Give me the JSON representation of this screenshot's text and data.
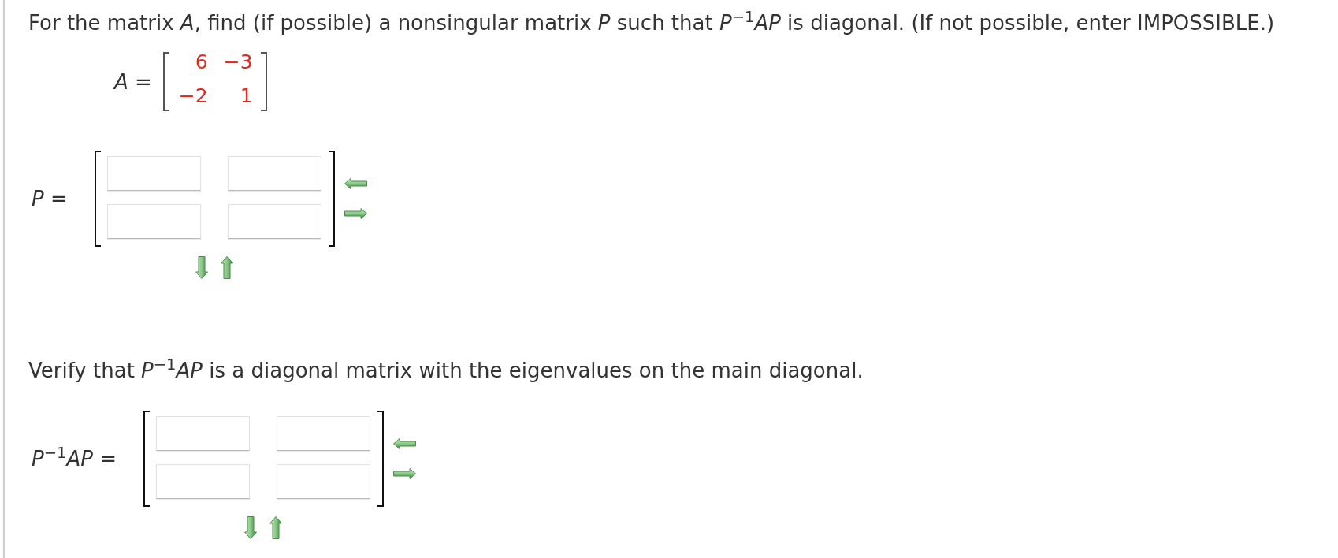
{
  "sections": [
    {
      "kind": "question",
      "text": "For the matrix *A*, find (if possible) a nonsingular matrix *P* such that *P*$^{−1}$*AP* is diagonal. (If not possible, enter IMPOSSIBLE.)"
    },
    {
      "kind": "given_matrix",
      "label": "*A* =",
      "rows": [
        [
          "6",
          "−3"
        ],
        [
          "−2",
          "1"
        ]
      ]
    },
    {
      "kind": "answer_matrix",
      "label": "*P* =",
      "rows": [
        [
          {
            "kind": "input"
          },
          {
            "kind": "input"
          }
        ],
        [
          {
            "kind": "input"
          },
          {
            "kind": "input"
          }
        ]
      ]
    },
    {
      "kind": "instruction",
      "text": "Verify that *P*$^{−1}$*AP* is a diagonal matrix with the eigenvalues on the main diagonal."
    },
    {
      "kind": "answer_matrix",
      "label": "*P*$^{−1}$*AP* =",
      "rows": [
        [
          {
            "kind": "input"
          },
          {
            "kind": "input"
          }
        ],
        [
          {
            "kind": "input"
          },
          {
            "kind": "input"
          }
        ]
      ]
    }
  ]
}
